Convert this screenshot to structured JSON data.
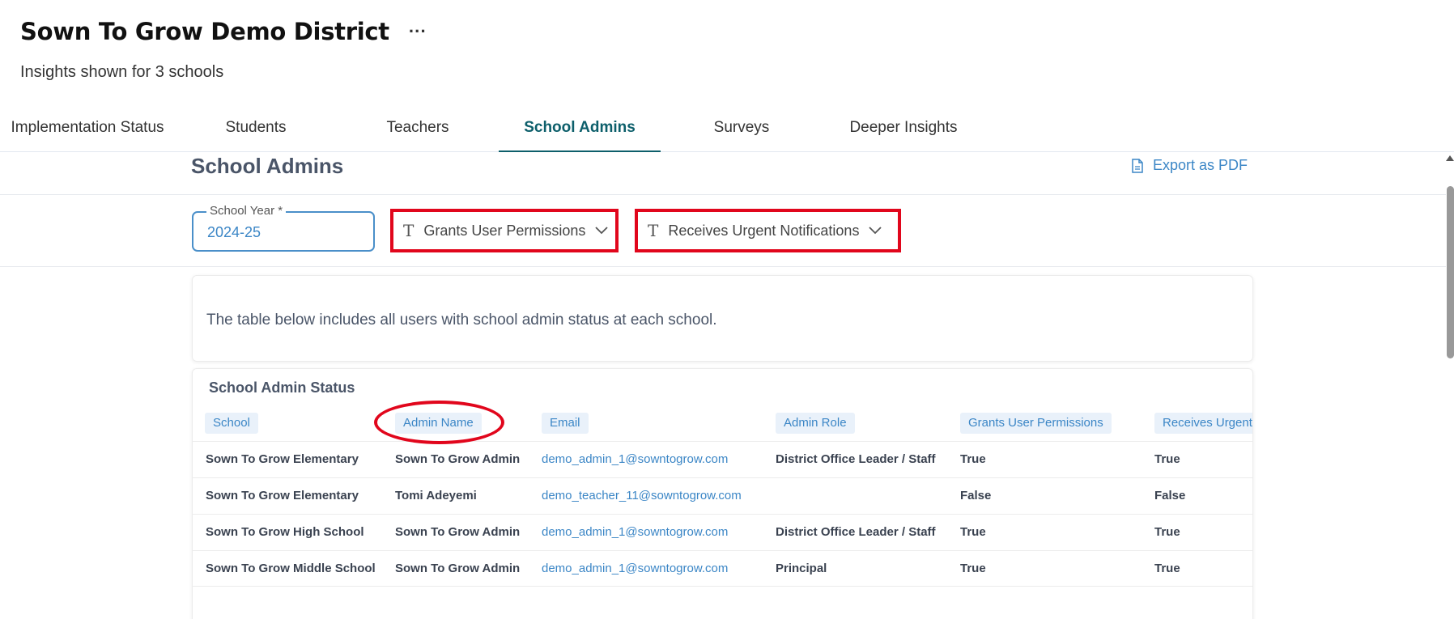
{
  "header": {
    "district_name": "Sown To Grow Demo District",
    "more_icon": "ellipsis-icon",
    "subtitle": "Insights shown for 3 schools"
  },
  "tabs": [
    {
      "label": "Implementation Status",
      "active": false
    },
    {
      "label": "Students",
      "active": false
    },
    {
      "label": "Teachers",
      "active": false
    },
    {
      "label": "School Admins",
      "active": true
    },
    {
      "label": "Surveys",
      "active": false
    },
    {
      "label": "Deeper Insights",
      "active": false
    }
  ],
  "page": {
    "heading": "School Admins",
    "export_label": "Export as PDF"
  },
  "filters": {
    "school_year_label": "School Year *",
    "school_year_value": "2024-25",
    "grants_dropdown": "Grants User Permissions",
    "urgent_dropdown": "Receives Urgent Notifications"
  },
  "info": {
    "text": "The table below includes all users with school admin status at each school."
  },
  "table": {
    "title": "School Admin Status",
    "columns": [
      "School",
      "Admin Name",
      "Email",
      "Admin Role",
      "Grants User Permissions",
      "Receives Urgent"
    ],
    "rows": [
      [
        "Sown To Grow Elementary",
        "Sown To Grow Admin",
        "demo_admin_1@sowntogrow.com",
        "District Office Leader / Staff",
        "True",
        "True"
      ],
      [
        "Sown To Grow Elementary",
        "Tomi Adeyemi",
        "demo_teacher_11@sowntogrow.com",
        "",
        "False",
        "False"
      ],
      [
        "Sown To Grow High School",
        "Sown To Grow Admin",
        "demo_admin_1@sowntogrow.com",
        "District Office Leader / Staff",
        "True",
        "True"
      ],
      [
        "Sown To Grow Middle School",
        "Sown To Grow Admin",
        "demo_admin_1@sowntogrow.com",
        "Principal",
        "True",
        "True"
      ]
    ]
  },
  "colors": {
    "accent": "#3b86c6",
    "active_tab": "#0d5f6b",
    "annotation_red": "#e1061c"
  }
}
